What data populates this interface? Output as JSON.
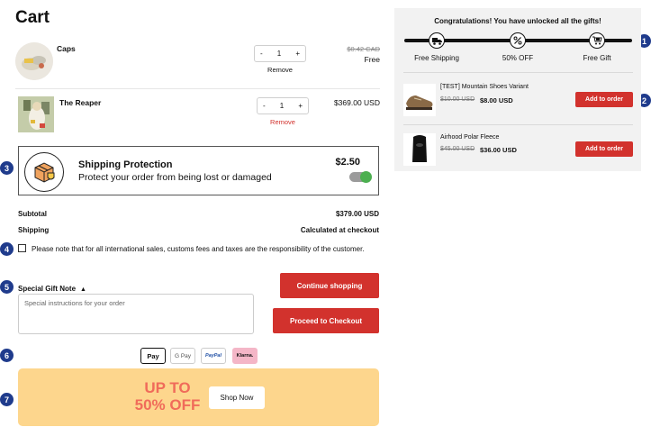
{
  "cart": {
    "title": "Cart"
  },
  "items": [
    {
      "name": "Caps",
      "quantity": "1",
      "remove_label": "Remove",
      "compare_price": "$0.42 CAD",
      "price": "Free"
    },
    {
      "name": "The Reaper",
      "quantity": "1",
      "remove_label": "Remove",
      "price": "$369.00 USD"
    }
  ],
  "qty_controls": {
    "minus": "-",
    "plus": "+"
  },
  "shipping_protection": {
    "title": "Shipping Protection",
    "subtitle": "Protect your order from being lost or damaged",
    "price": "$2.50",
    "enabled": true
  },
  "summary": {
    "subtotal_label": "Subtotal",
    "subtotal_value": "$379.00 USD",
    "shipping_label": "Shipping",
    "shipping_value": "Calculated at checkout"
  },
  "notice": "Please note that for all international sales, customs fees and taxes are the responsibility of the customer.",
  "gift_note": {
    "label": "Special Gift Note",
    "placeholder": "Special instructions for your order"
  },
  "buttons": {
    "continue": "Continue shopping",
    "checkout": "Proceed to Checkout"
  },
  "payment_methods": [
    {
      "name": "apple-pay-icon",
      "label": "Pay"
    },
    {
      "name": "google-pay-icon",
      "label": "G Pay"
    },
    {
      "name": "paypal-icon",
      "label": "PayPal"
    },
    {
      "name": "klarna-icon",
      "label": "Klarna."
    }
  ],
  "promo": {
    "line1": "UP TO",
    "line2": "50% OFF",
    "button": "Shop Now"
  },
  "rewards": {
    "title": "Congratulations! You have unlocked all the gifts!",
    "progress": 1.0,
    "steps": [
      {
        "label": "Free Shipping",
        "icon": "truck-icon"
      },
      {
        "label": "50% OFF",
        "icon": "percent-icon"
      },
      {
        "label": "Free Gift",
        "icon": "gift-cart-icon"
      }
    ]
  },
  "offers": [
    {
      "name": "[TEST] Mountain Shoes Variant",
      "compare_price": "$10.00 USD",
      "price": "$8.00 USD",
      "button": "Add to order"
    },
    {
      "name": "Airhood Polar Fleece",
      "compare_price": "$45.00 USD",
      "price": "$36.00 USD",
      "button": "Add to order"
    }
  ],
  "markers": [
    "1",
    "2",
    "3",
    "4",
    "5",
    "6",
    "7"
  ],
  "colors": {
    "accent_red": "#d2322d",
    "marker_blue": "#1f3b8c",
    "promo_bg": "#fdd68d",
    "promo_text": "#f06b5a",
    "toggle_on": "#4caf50"
  }
}
